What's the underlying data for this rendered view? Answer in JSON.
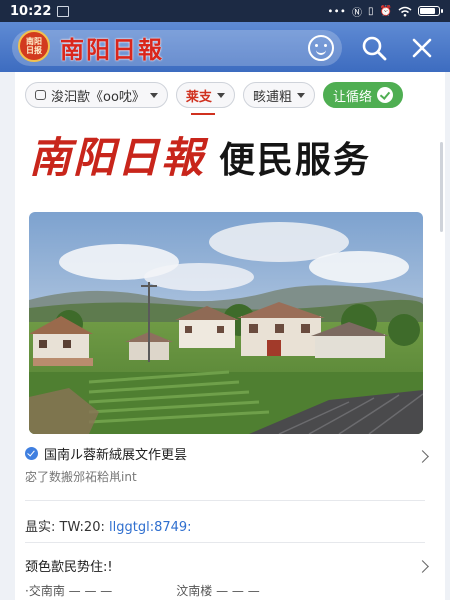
{
  "status_bar": {
    "time": "10:22",
    "icons": [
      "image-icon",
      "dots-icon",
      "nfc-icon",
      "vibrate-icon",
      "alarm-icon",
      "wifi-icon",
      "battery-icon"
    ],
    "battery_level": 0.9
  },
  "header": {
    "logo_text": "南阳\n日报",
    "brand": "南阳日報",
    "colors": {
      "bar": "#4a78c9",
      "brand_red": "#d9261c"
    }
  },
  "filters": [
    {
      "label": "浚汩歖《oo㕪》",
      "kind": "dropdown"
    },
    {
      "label": "莱支",
      "kind": "dropdown",
      "active": true
    },
    {
      "label": "畡逋粗",
      "kind": "dropdown"
    },
    {
      "label": "让循络",
      "kind": "follow"
    }
  ],
  "headline": {
    "brand": "南阳日報",
    "title": "便民服务"
  },
  "hero": {
    "alt_icon": "village-photo"
  },
  "items": {
    "first": {
      "title": "国南ル蓉新絨展文作更昙",
      "subtitle": "宓了数搬邠祏粭鼡int"
    },
    "second": {
      "label": "昷实: TW:20:",
      "link": "llggtgl:8749:"
    },
    "third": {
      "title": "颈色歖民势住:!"
    },
    "fourth": {
      "left": "·交南南 — — —",
      "right": "汶南楼 — — —"
    }
  },
  "colors": {
    "accent_red": "#d0311f",
    "follow_green": "#4fae52",
    "link_blue": "#2f6fcf"
  }
}
